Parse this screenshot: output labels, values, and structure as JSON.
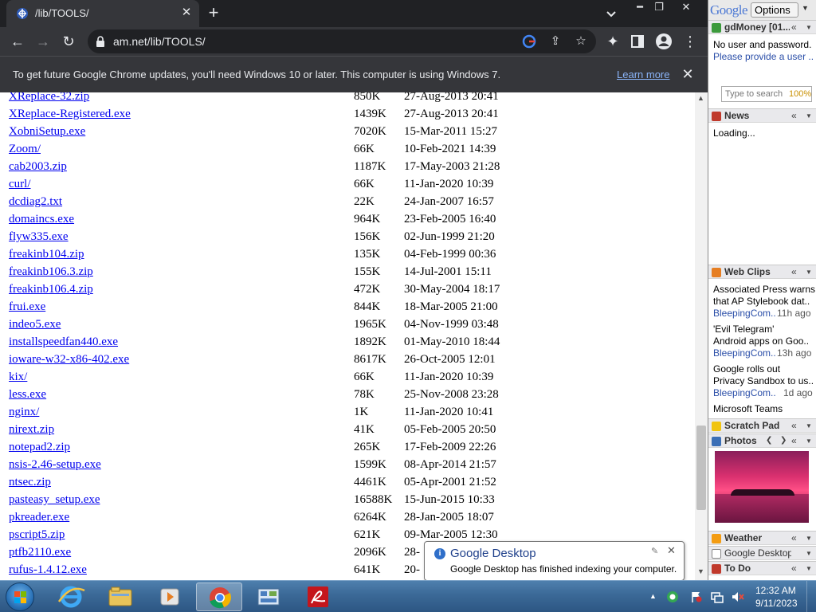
{
  "browser": {
    "tab_title": "/lib/TOOLS/",
    "url": "am.net/lib/TOOLS/",
    "infobar_text": "To get future Google Chrome updates, you'll need Windows 10 or later. This computer is using Windows 7.",
    "infobar_link": "Learn more"
  },
  "listing": [
    {
      "name": "XReplace-32.zip",
      "size": "850K",
      "date": "27-Aug-2013 20:41"
    },
    {
      "name": "XReplace-Registered.exe",
      "size": "1439K",
      "date": "27-Aug-2013 20:41"
    },
    {
      "name": "XobniSetup.exe",
      "size": "7020K",
      "date": "15-Mar-2011 15:27"
    },
    {
      "name": "Zoom/",
      "size": "66K",
      "date": "10-Feb-2021 14:39"
    },
    {
      "name": "cab2003.zip",
      "size": "1187K",
      "date": "17-May-2003 21:28"
    },
    {
      "name": "curl/",
      "size": "66K",
      "date": "11-Jan-2020 10:39"
    },
    {
      "name": "dcdiag2.txt",
      "size": "22K",
      "date": "24-Jan-2007 16:57"
    },
    {
      "name": "domaincs.exe",
      "size": "964K",
      "date": "23-Feb-2005 16:40"
    },
    {
      "name": "flyw335.exe",
      "size": "156K",
      "date": "02-Jun-1999 21:20"
    },
    {
      "name": "freakinb104.zip",
      "size": "135K",
      "date": "04-Feb-1999 00:36"
    },
    {
      "name": "freakinb106.3.zip",
      "size": "155K",
      "date": "14-Jul-2001 15:11"
    },
    {
      "name": "freakinb106.4.zip",
      "size": "472K",
      "date": "30-May-2004 18:17"
    },
    {
      "name": "frui.exe",
      "size": "844K",
      "date": "18-Mar-2005 21:00"
    },
    {
      "name": "indeo5.exe",
      "size": "1965K",
      "date": "04-Nov-1999 03:48"
    },
    {
      "name": "installspeedfan440.exe",
      "size": "1892K",
      "date": "01-May-2010 18:44"
    },
    {
      "name": "ioware-w32-x86-402.exe",
      "size": "8617K",
      "date": "26-Oct-2005 12:01"
    },
    {
      "name": "kix/",
      "size": "66K",
      "date": "11-Jan-2020 10:39"
    },
    {
      "name": "less.exe",
      "size": "78K",
      "date": "25-Nov-2008 23:28"
    },
    {
      "name": "nginx/",
      "size": "1K",
      "date": "11-Jan-2020 10:41"
    },
    {
      "name": "nirext.zip",
      "size": "41K",
      "date": "05-Feb-2005 20:50"
    },
    {
      "name": "notepad2.zip",
      "size": "265K",
      "date": "17-Feb-2009 22:26"
    },
    {
      "name": "nsis-2.46-setup.exe",
      "size": "1599K",
      "date": "08-Apr-2014 21:57"
    },
    {
      "name": "ntsec.zip",
      "size": "4461K",
      "date": "05-Apr-2001 21:52"
    },
    {
      "name": "pasteasy_setup.exe",
      "size": "16588K",
      "date": "15-Jun-2015 10:33"
    },
    {
      "name": "pkreader.exe",
      "size": "6264K",
      "date": "28-Jan-2005 18:07"
    },
    {
      "name": "pscript5.zip",
      "size": "621K",
      "date": "09-Mar-2005 12:30"
    },
    {
      "name": "ptfb2110.exe",
      "size": "2096K",
      "date": "28-"
    },
    {
      "name": "rufus-1.4.12.exe",
      "size": "641K",
      "date": "20-"
    }
  ],
  "sidebar": {
    "logo": "Google",
    "options_label": "Options",
    "gdmoney_title": "gdMoney [01...",
    "gdmoney_msg": "No user and password.",
    "gdmoney_link": "Please provide a user ..",
    "search_placeholder": "Type to search",
    "search_percent": "100%",
    "news_title": "News",
    "news_status": "Loading...",
    "webclips_title": "Web Clips",
    "clips": [
      {
        "line1": "Associated Press warns",
        "line2": "that AP Stylebook dat..",
        "source": "BleepingCom..",
        "time": "11h ago"
      },
      {
        "line1": "'Evil Telegram'",
        "line2": "Android apps on Goo..",
        "source": "BleepingCom..",
        "time": "13h ago"
      },
      {
        "line1": "Google rolls out",
        "line2": "Privacy Sandbox to us..",
        "source": "BleepingCom..",
        "time": "1d ago"
      },
      {
        "line1": "Microsoft Teams",
        "line2": "",
        "source": "",
        "time": ""
      }
    ],
    "scratchpad_title": "Scratch Pad",
    "photos_title": "Photos",
    "weather_title": "Weather",
    "gdesktop_title": "Google Desktop",
    "todo_title": "To Do"
  },
  "notification": {
    "title": "Google Desktop",
    "body": "Google Desktop has finished indexing your computer."
  },
  "taskbar": {
    "time": "12:32 AM",
    "date": "9/11/2023"
  }
}
